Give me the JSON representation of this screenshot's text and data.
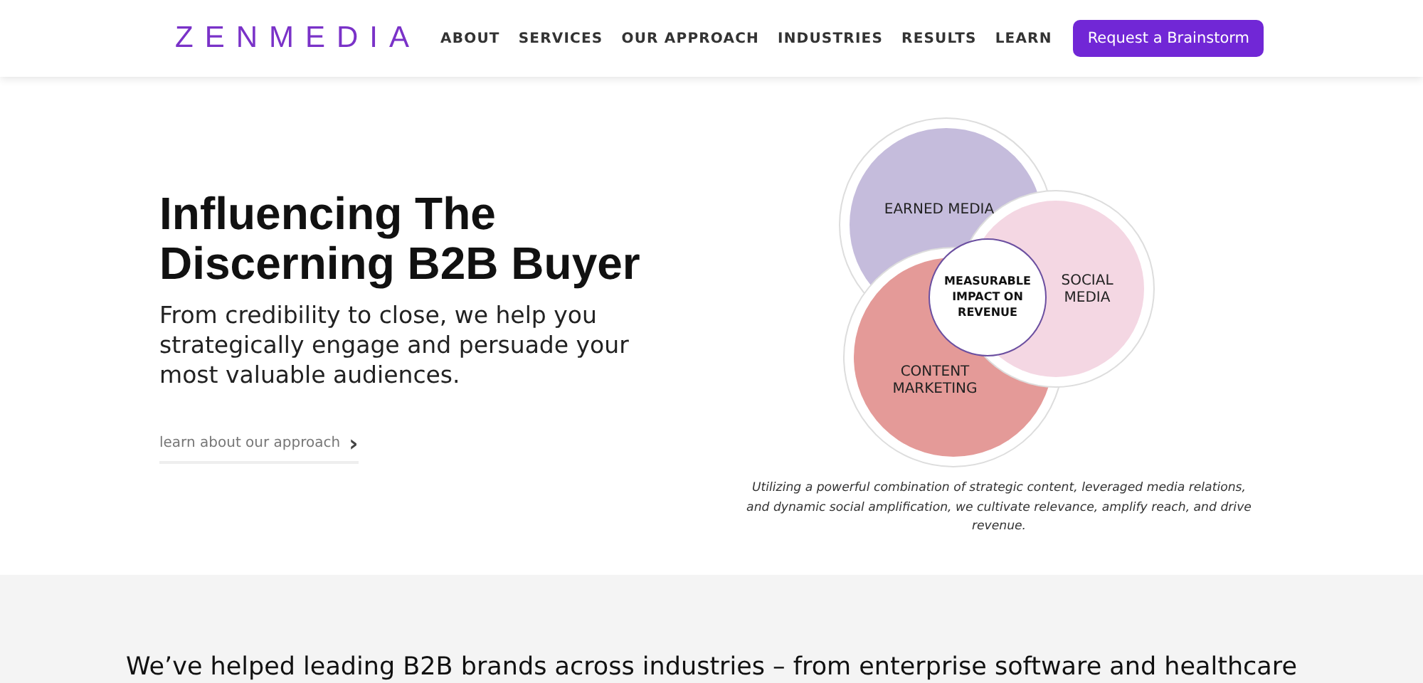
{
  "header": {
    "logo": "ZENMEDIA",
    "nav": [
      {
        "label": "ABOUT"
      },
      {
        "label": "SERVICES"
      },
      {
        "label": "OUR APPROACH"
      },
      {
        "label": "INDUSTRIES"
      },
      {
        "label": "RESULTS"
      },
      {
        "label": "LEARN"
      }
    ],
    "cta": "Request a Brainstorm"
  },
  "hero": {
    "title_lines": [
      "Influencing The",
      "Discerning B2B Buyer"
    ],
    "subtitle": "From credibility to close, we help you strategically engage and persuade your most valuable audiences.",
    "link": "learn about our approach",
    "link_icon": "›"
  },
  "diagram": {
    "circles": [
      {
        "kind": "earned",
        "lines": [
          "EARNED MEDIA"
        ],
        "color": "#c5bcdc"
      },
      {
        "kind": "content",
        "lines": [
          "CONTENT",
          "MARKETING"
        ],
        "color": "#e49a98"
      },
      {
        "kind": "social",
        "lines": [
          "SOCIAL",
          "MEDIA"
        ],
        "color": "#f4d7e3"
      }
    ],
    "center_lines": [
      "MEASURABLE",
      "IMPACT ON",
      "REVENUE"
    ],
    "caption": "Utilizing a powerful combination of strategic content, leveraged media relations, and dynamic social amplification, we cultivate relevance, amplify reach, and drive revenue."
  },
  "section": {
    "text": "We’ve helped leading B2B brands across industries – from enterprise software and healthcare"
  }
}
